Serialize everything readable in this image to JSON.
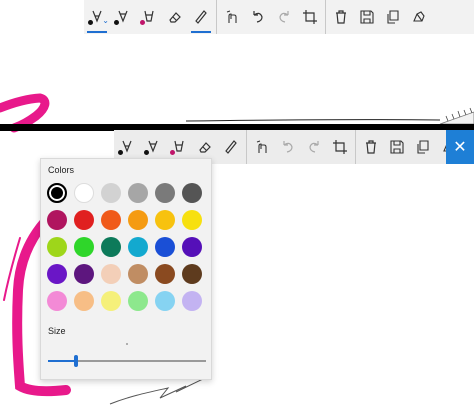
{
  "top_toolbar": {
    "tools": [
      {
        "icon": "ballpoint-pen-icon",
        "dot": "#111111",
        "active": true,
        "chevron": true
      },
      {
        "icon": "pencil-icon",
        "dot": "#111111",
        "active": false
      },
      {
        "icon": "highlighter-icon",
        "dot": "#c0166b",
        "active": false
      },
      {
        "icon": "eraser-icon",
        "active": false
      },
      {
        "icon": "ruler-icon",
        "active": true
      },
      {
        "icon": "touch-writing-icon",
        "active": false
      },
      {
        "icon": "undo-icon",
        "active": false
      },
      {
        "icon": "redo-icon",
        "active": false,
        "disabled": true
      },
      {
        "icon": "crop-icon",
        "active": false
      },
      {
        "icon": "delete-icon",
        "active": false
      },
      {
        "icon": "save-icon",
        "active": false
      },
      {
        "icon": "copy-icon",
        "active": false
      },
      {
        "icon": "share-icon",
        "active": false
      }
    ]
  },
  "bottom_toolbar": {
    "close_glyph": "✕"
  },
  "color_flyout": {
    "title": "Colors",
    "size_label": "Size",
    "size_value": 0.18,
    "selected_color": "#000000",
    "colors": [
      "#000000",
      "#ffffff",
      "#d2d2d2",
      "#a6a6a6",
      "#7a7a7a",
      "#555555",
      "#b0155f",
      "#e02020",
      "#f05a1a",
      "#f59b12",
      "#f7c20f",
      "#f7e00f",
      "#9ed61a",
      "#2fd62a",
      "#0d7a5a",
      "#13a9cf",
      "#1a4fd6",
      "#5510b8",
      "#6a16c6",
      "#5d167e",
      "#f3cfb8",
      "#c08d63",
      "#8a4a20",
      "#5e3b1e",
      "#f38ad6",
      "#f7be86",
      "#f5f07a",
      "#8de88d",
      "#86d3f2",
      "#c3b3f2"
    ]
  },
  "colors": {
    "accent": "#1f6fd1",
    "ink_magenta": "#e8198b"
  }
}
